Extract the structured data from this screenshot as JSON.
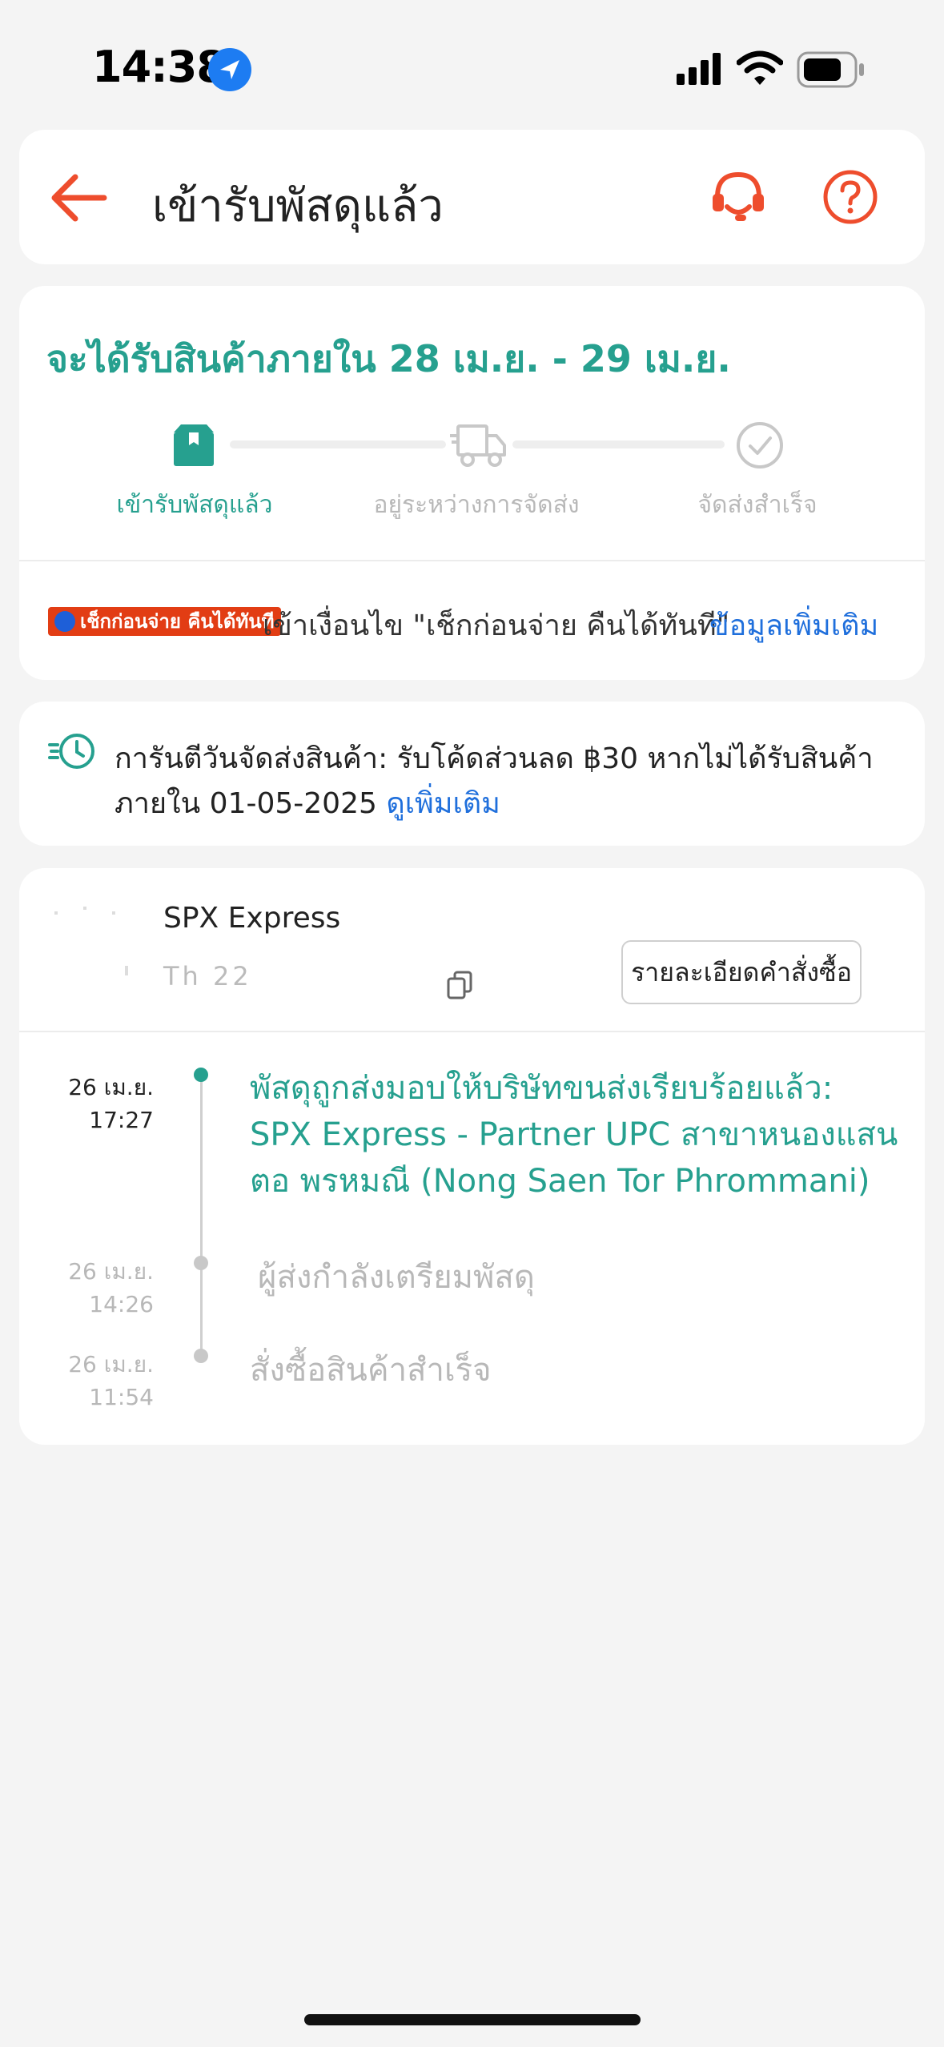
{
  "status_bar": {
    "time": "14:38"
  },
  "header": {
    "title": "เข้ารับพัสดุแล้ว"
  },
  "delivery": {
    "eta": "จะได้รับสินค้าภายใน 28 เม.ย. - 29 เม.ย.",
    "steps": [
      {
        "label": "เข้ารับพัสดุแล้ว",
        "icon": "package-icon",
        "active": true
      },
      {
        "label": "อยู่ระหว่างการจัดส่ง",
        "icon": "truck-icon",
        "active": false
      },
      {
        "label": "จัดส่งสำเร็จ",
        "icon": "check-circle-icon",
        "active": false
      }
    ]
  },
  "cod": {
    "badge": "เช็กก่อนจ่าย คืนได้ทันที",
    "text": "เข้าเงื่อนไข \"เช็กก่อนจ่าย คืนได้ทันที\"",
    "link": "ข้อมูลเพิ่มเติม"
  },
  "guarantee": {
    "line1": "การันตีวันจัดส่งสินค้า: รับโค้ดส่วนลด ฿30 หากไม่ได้รับสินค้า",
    "line2": "ภายใน 01-05-2025",
    "link": "ดูเพิ่มเติม"
  },
  "shipment": {
    "carrier": "SPX Express",
    "tracking_partial": "Th          22",
    "detail_button": "รายละเอียดคำสั่งซื้อ"
  },
  "timeline": [
    {
      "date": "26 เม.ย.",
      "time": "17:27",
      "lines": [
        "พัสดุถูกส่งมอบให้บริษัทขนส่งเรียบร้อยแล้ว:",
        "SPX Express - Partner UPC สาขาหนองแสน",
        "ตอ พรหมณี (Nong Saen Tor Phrommani)"
      ]
    },
    {
      "date": "26 เม.ย.",
      "time": "14:26",
      "lines": [
        "ผู้ส่งกำลังเตรียมพัสดุ"
      ]
    },
    {
      "date": "26 เม.ย.",
      "time": "11:54",
      "lines": [
        "สั่งซื้อสินค้าสำเร็จ"
      ]
    }
  ],
  "colors": {
    "accent": "#26a08f",
    "brand": "#ee4d2d",
    "link": "#1f6fdc"
  }
}
